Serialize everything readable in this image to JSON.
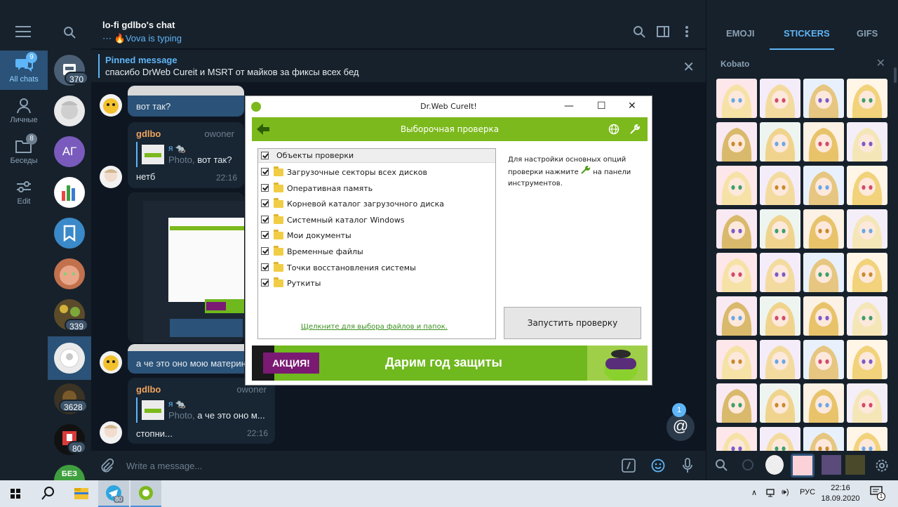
{
  "telegram": {
    "folders": [
      {
        "label": "All chats",
        "badge": "9"
      },
      {
        "label": "Личные",
        "badge": ""
      },
      {
        "label": "Беседы",
        "badge": "8"
      },
      {
        "label": "Edit",
        "badge": ""
      }
    ],
    "chat_counts": {
      "first": "370",
      "fifth": "339",
      "c3628": "3628",
      "c80": "80"
    },
    "avatar_initials": "АГ",
    "bottom_avatar_text": "БЕЗ",
    "chat": {
      "title": "lo-fi gdlbo's chat",
      "status": "Vova is typing"
    },
    "pinned": {
      "title": "Pinned message",
      "text": "спасибо DrWeb Cureit и MSRT от майков за фиксы всех бед"
    },
    "messages": [
      {
        "text": "вот так?"
      },
      {
        "name": "gdlbo",
        "role": "owoner",
        "reply_name": "я 🐀",
        "reply_prefix": "Photo,",
        "reply_text": "вот так?",
        "text": "нетб",
        "time": "22:16"
      },
      {
        "text": "а че это оно мою материн"
      },
      {
        "name": "gdlbo",
        "role": "owoner",
        "reply_name": "я 🐀",
        "reply_prefix": "Photo,",
        "reply_text": "а че это оно м...",
        "text": "стопни...",
        "time": "22:16"
      }
    ],
    "mentions": "1",
    "compose_placeholder": "Write a message...",
    "stickers": {
      "tabs": [
        "EMOJI",
        "STICKERS",
        "GIFS"
      ],
      "set_name": "Kobato"
    }
  },
  "drweb": {
    "title": "Dr.Web CureIt!",
    "header": "Выборочная проверка",
    "tree_header": "Объекты проверки",
    "items": [
      "Загрузочные секторы всех дисков",
      "Оперативная память",
      "Корневой каталог загрузочного диска",
      "Системный каталог Windows",
      "Мои документы",
      "Временные файлы",
      "Точки восстановления системы",
      "Руткиты"
    ],
    "pick_link": "Щелкните для выбора файлов и папок.",
    "hint_before": "Для настройки основных опций проверки нажмите",
    "hint_after": "на панели инструментов.",
    "run_button": "Запустить проверку",
    "promo_tag": "АКЦИЯ!",
    "promo_text": "Дарим год защиты"
  },
  "taskbar": {
    "lang": "РУС",
    "time": "22:16",
    "date": "18.09.2020",
    "notif": "1",
    "tg_badge": "80"
  },
  "colors": {
    "accent": "#5eb5f7",
    "drweb_green": "#7cb91c",
    "promo_purple": "#7a1a73"
  }
}
